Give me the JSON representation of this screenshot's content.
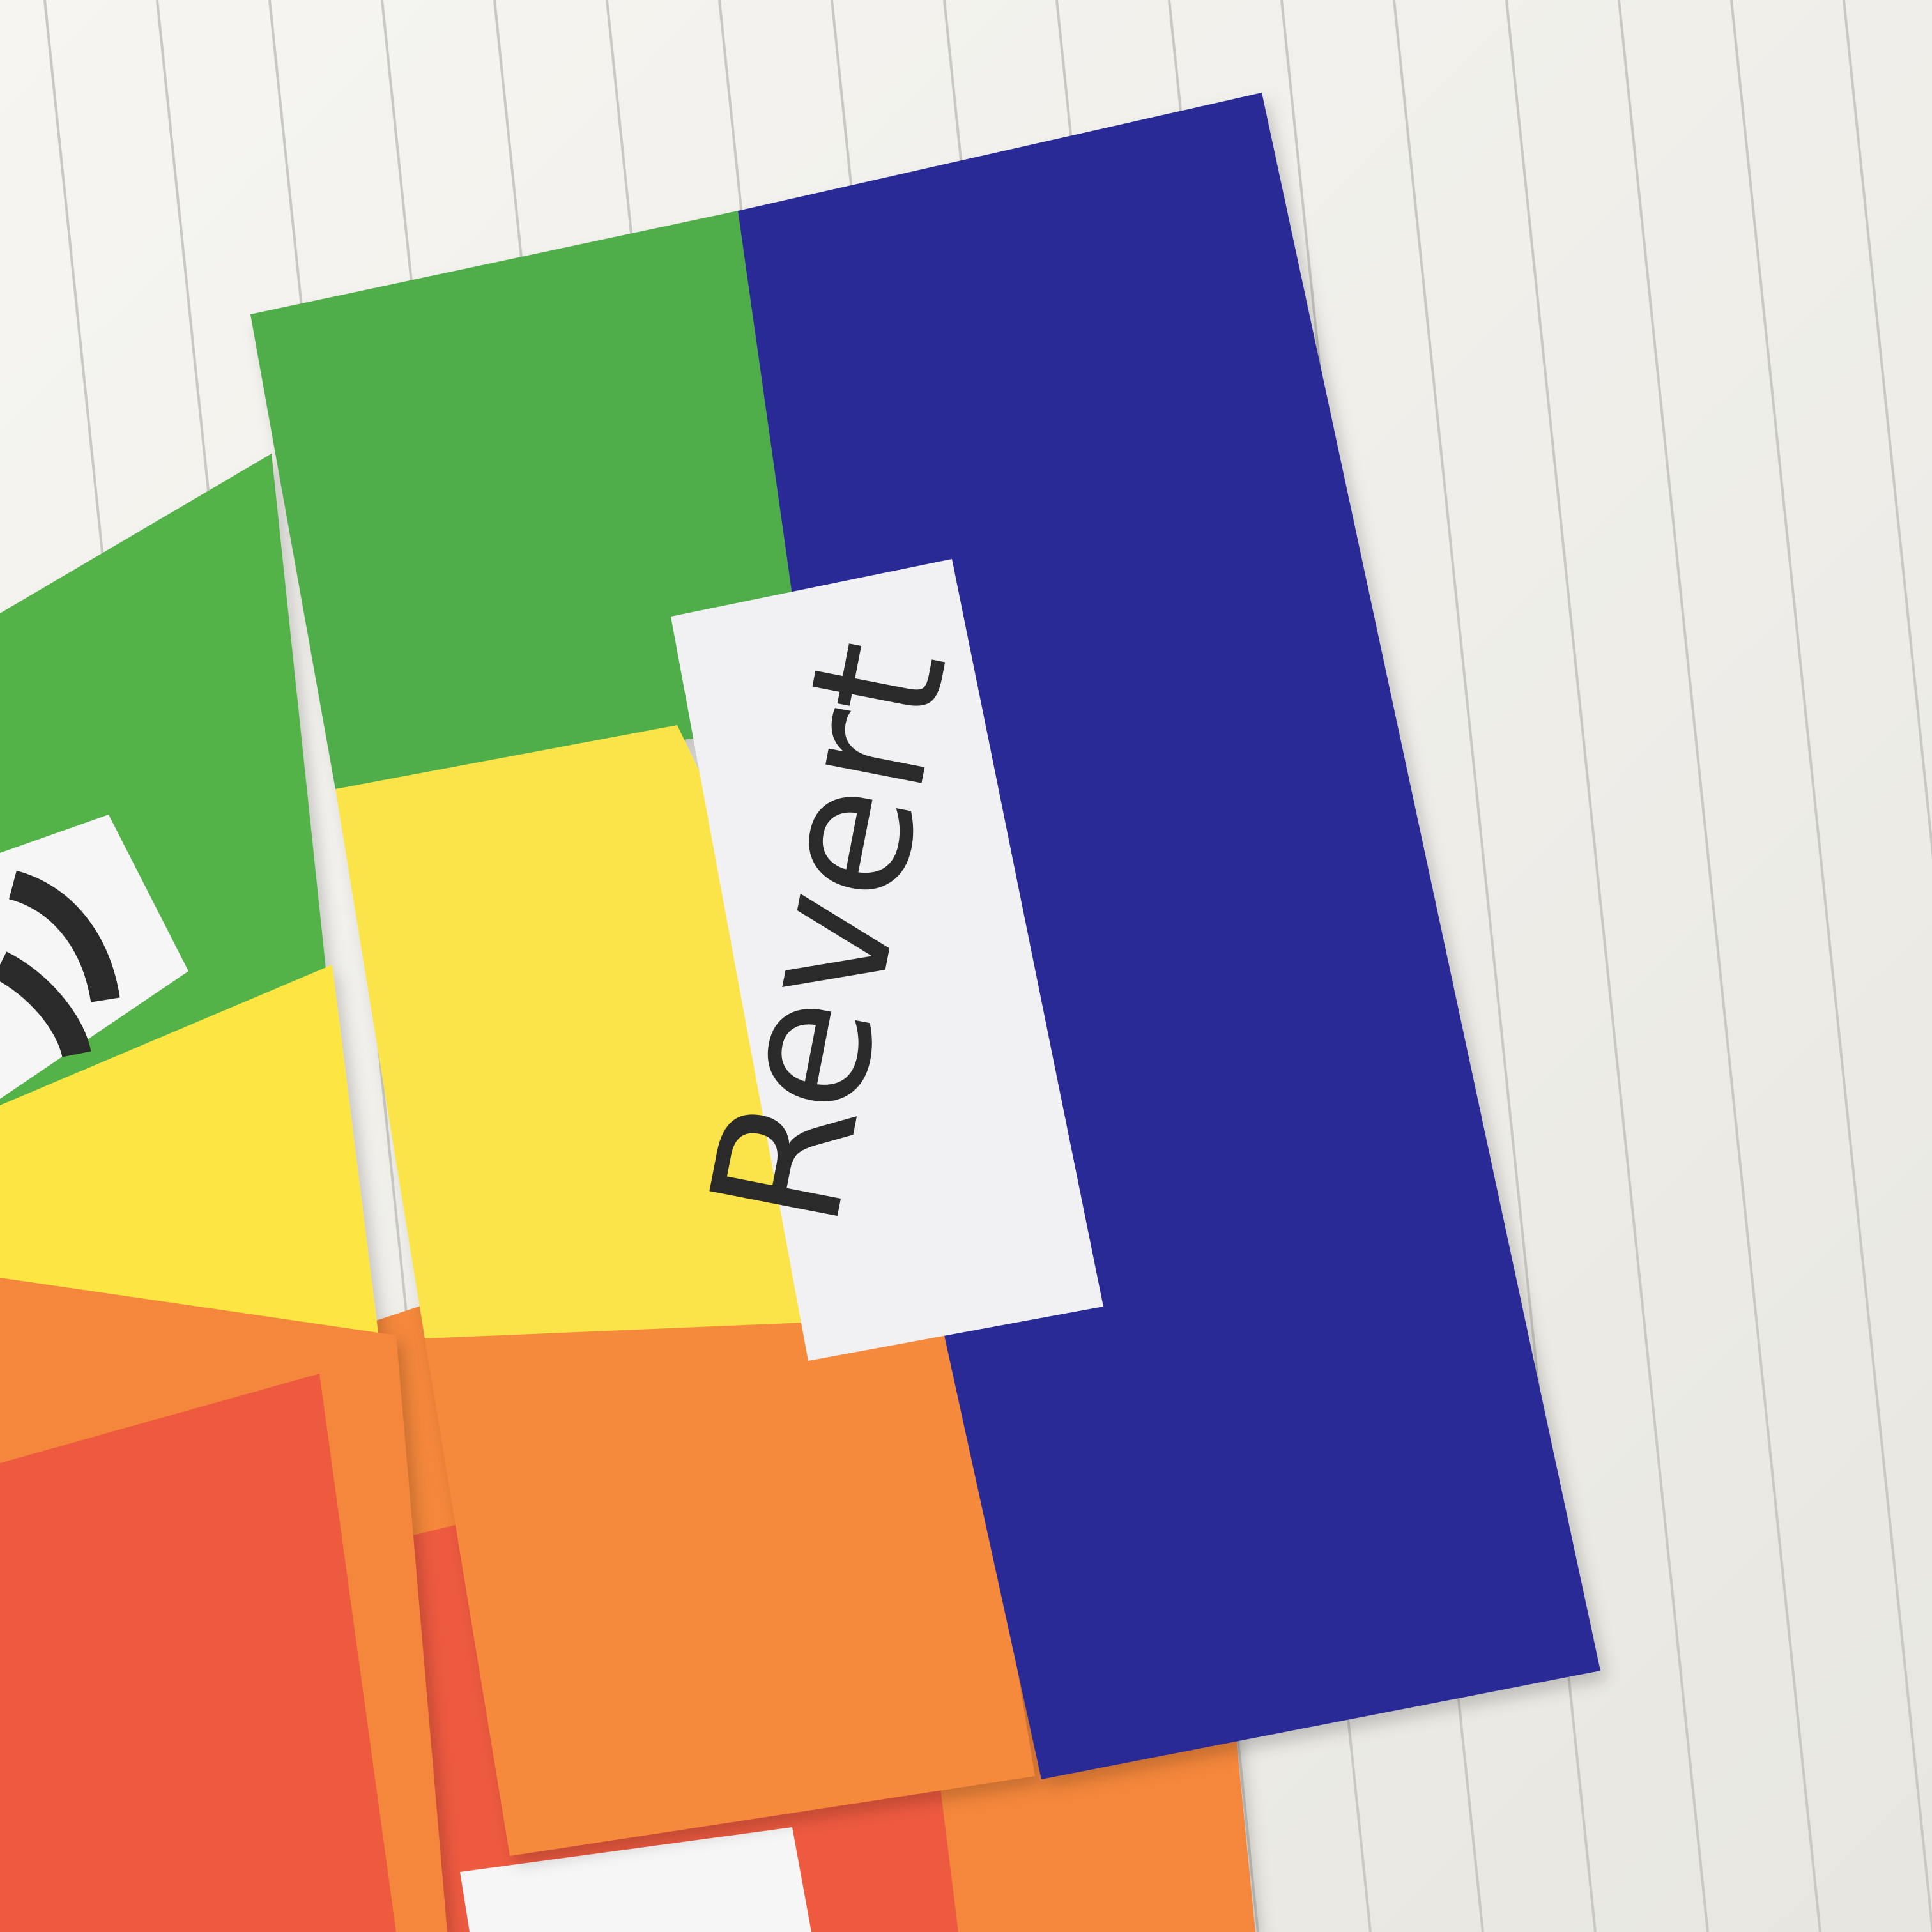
{
  "photo": {
    "subject": "business-cards",
    "front_card": {
      "label": "Revert",
      "colors": {
        "green": "#4fae48",
        "yellow": "#fbe44a",
        "orange": "#f58a3c",
        "blue": "#2a2a97",
        "label_panel": "#f1f1f3",
        "text": "#2b2b2b"
      }
    },
    "back_cards": {
      "colors": {
        "green": "#52b34a",
        "yellow": "#fde542",
        "orange": "#f4873b",
        "red": "#ee5a3f"
      }
    },
    "paper": {
      "background": "#f2f1ec",
      "rule_line": "#c9c8c2"
    }
  }
}
